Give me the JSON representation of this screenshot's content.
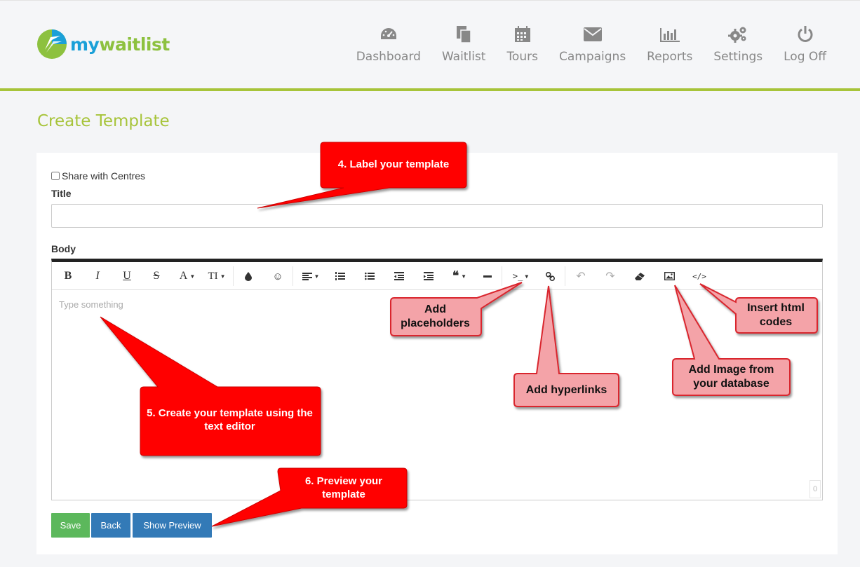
{
  "header": {
    "logo": {
      "my": "my",
      "waitlist": "waitlist"
    },
    "nav": [
      {
        "label": "Dashboard",
        "icon": "dashboard-icon"
      },
      {
        "label": "Waitlist",
        "icon": "waitlist-icon"
      },
      {
        "label": "Tours",
        "icon": "calendar-icon"
      },
      {
        "label": "Campaigns",
        "icon": "envelope-icon"
      },
      {
        "label": "Reports",
        "icon": "bar-chart-icon"
      },
      {
        "label": "Settings",
        "icon": "gears-icon"
      },
      {
        "label": "Log Off",
        "icon": "power-icon"
      }
    ]
  },
  "page": {
    "title": "Create Template"
  },
  "form": {
    "share_label": "Share with Centres",
    "title_label": "Title",
    "title_value": "",
    "body_label": "Body",
    "body_placeholder": "Type something",
    "char_count": "0"
  },
  "toolbar": {
    "bold": "B",
    "italic": "I",
    "underline": "U",
    "strikethrough": "S",
    "font_color": "A",
    "font_size": "TI"
  },
  "buttons": {
    "save": "Save",
    "back": "Back",
    "show_preview": "Show Preview"
  },
  "callouts": {
    "label_template": "4. Label your template",
    "create_template": "5. Create your template using the text editor",
    "preview_template": "6. Preview your template",
    "add_placeholders": "Add placeholders",
    "add_hyperlinks": "Add hyperlinks",
    "add_image": "Add Image from your database",
    "insert_html": "Insert html codes"
  },
  "colors": {
    "brand_green": "#a7c43a",
    "brand_blue": "#1aa0d8",
    "callout_red": "#ff0000",
    "callout_pink": "#f4a3a8",
    "save_green": "#5cb85c",
    "button_blue": "#337ab7"
  }
}
